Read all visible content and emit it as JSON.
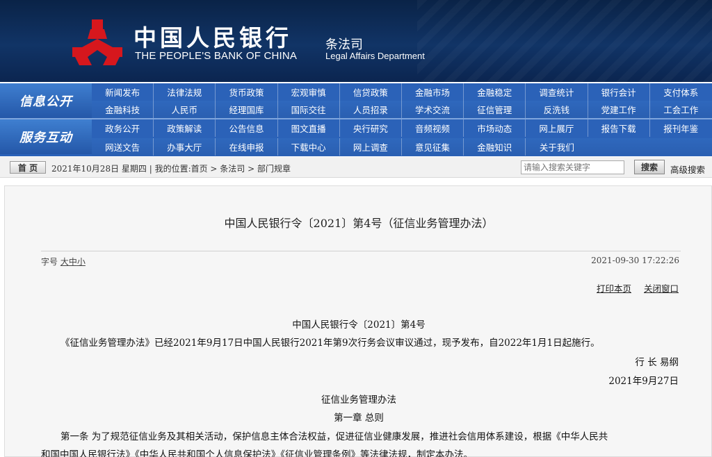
{
  "header": {
    "brand_cn": "中国人民银行",
    "brand_en": "THE PEOPLE'S BANK OF CHINA",
    "dept_cn": "条法司",
    "dept_en": "Legal Affairs Department",
    "logo_icon": "pboc-logo-icon"
  },
  "nav": {
    "group1_label": "信息公开",
    "group1_row1": [
      "新闻发布",
      "法律法规",
      "货币政策",
      "宏观审慎",
      "信贷政策",
      "金融市场",
      "金融稳定",
      "调查统计",
      "银行会计",
      "支付体系"
    ],
    "group1_row2": [
      "金融科技",
      "人民币",
      "经理国库",
      "国际交往",
      "人员招录",
      "学术交流",
      "征信管理",
      "反洗钱",
      "党建工作",
      "工会工作"
    ],
    "group2_label": "服务互动",
    "group2_row1": [
      "政务公开",
      "政策解读",
      "公告信息",
      "图文直播",
      "央行研究",
      "音频视频",
      "市场动态",
      "网上展厅",
      "报告下载",
      "报刊年鉴"
    ],
    "group2_row2": [
      "网送文告",
      "办事大厅",
      "在线申报",
      "下载中心",
      "网上调查",
      "意见征集",
      "金融知识",
      "关于我们"
    ]
  },
  "crumbbar": {
    "home_label": "首 页",
    "date_path": "2021年10月28日 星期四 | 我的位置:首页 > 条法司 > 部门规章",
    "search_placeholder": "请输入搜索关键字",
    "search_button": "搜索",
    "advanced_search": "高级搜索"
  },
  "article": {
    "title": "中国人民银行令〔2021〕第4号（征信业务管理办法）",
    "font_size_label": "字号",
    "font_large": "大",
    "font_medium": "中",
    "font_small": "小",
    "datetime": "2021-09-30 17:22:26",
    "print_link": "打印本页",
    "close_link": "关闭窗口",
    "order_no": "中国人民银行令〔2021〕第4号",
    "intro": "《征信业务管理办法》已经2021年9月17日中国人民银行2021年第9次行务会议审议通过，现予发布，自2022年1月1日起施行。",
    "signer": "行 长 易纲",
    "sign_date": "2021年9月27日",
    "doc_name": "征信业务管理办法",
    "chapter1": "第一章 总则",
    "article1_line1": "第一条 为了规范征信业务及其相关活动，保护信息主体合法权益，促进征信业健康发展，推进社会信用体系建设，根据《中华人民共",
    "article1_line2": "和国中国人民银行法》《中华人民共和国个人信息保护法》《征信业管理条例》等法律法规，制定本办法。"
  }
}
